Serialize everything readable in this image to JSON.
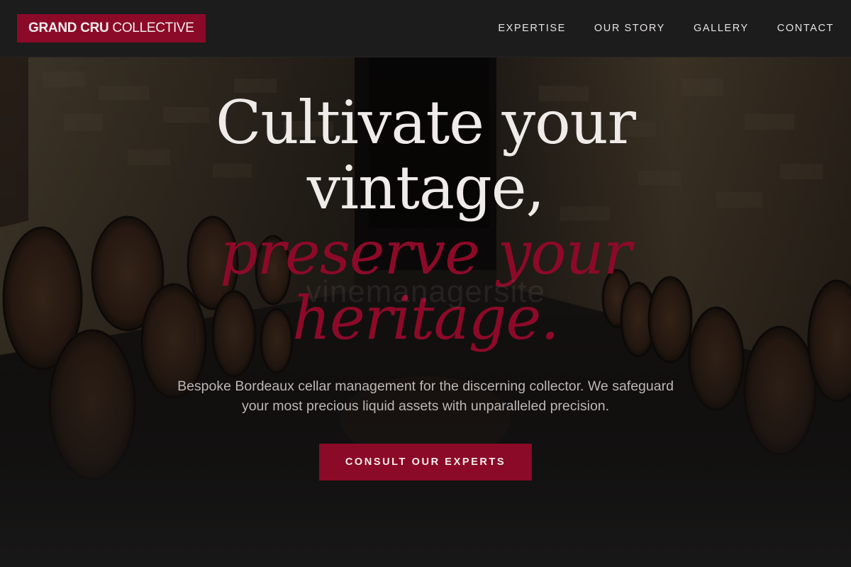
{
  "header": {
    "logo_bold": "GRAND CRU",
    "logo_light": "COLLECTIVE",
    "nav": [
      {
        "label": "EXPERTISE"
      },
      {
        "label": "OUR STORY"
      },
      {
        "label": "GALLERY"
      },
      {
        "label": "CONTACT"
      }
    ]
  },
  "hero": {
    "headline_line1": "Cultivate your",
    "headline_line2": "vintage,",
    "headline_accent1": "preserve your",
    "headline_accent2": "heritage.",
    "watermark": "vinemanagersite",
    "subtitle": "Bespoke Bordeaux cellar management for the discerning collector. We safeguard your most precious liquid assets with unparalleled precision.",
    "cta_label": "CONSULT OUR EXPERTS"
  },
  "colors": {
    "accent": "#8b0a27",
    "header_bg": "#1c1c1c",
    "text_light": "#efebe9"
  }
}
